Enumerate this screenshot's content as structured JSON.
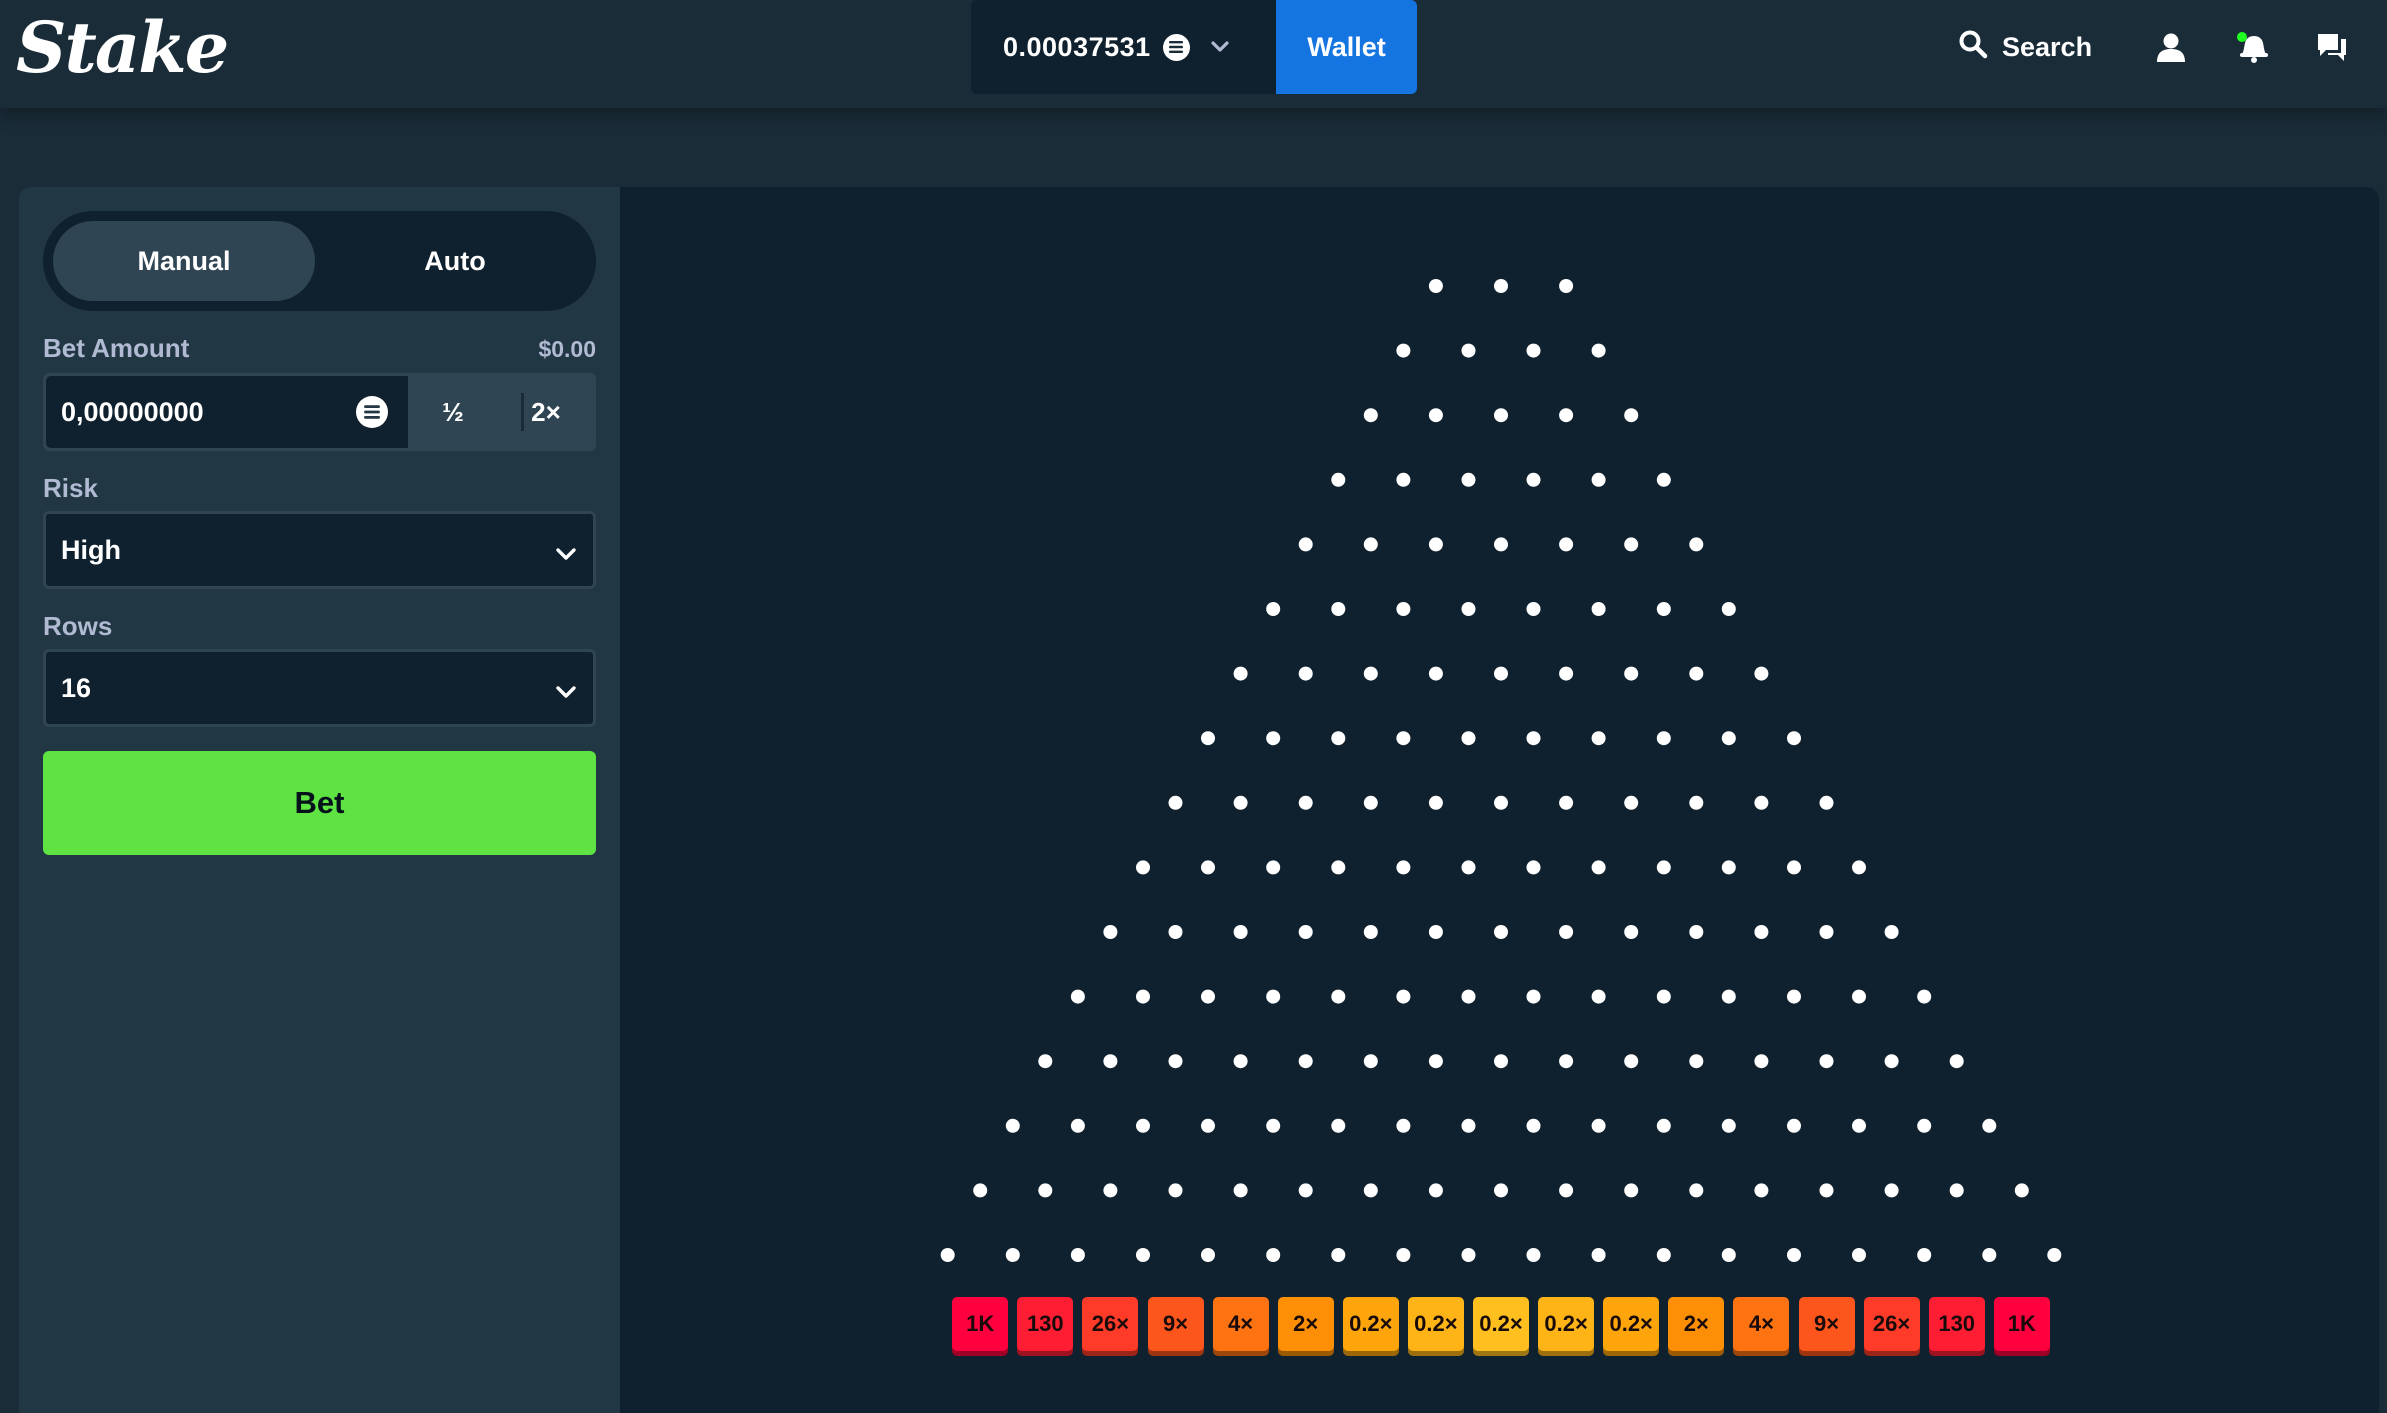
{
  "header": {
    "logo_text": "Stake",
    "balance": "0.00037531",
    "currency_icon": "coin-icon",
    "wallet_label": "Wallet",
    "search_label": "Search",
    "icons": [
      "user-icon",
      "notifications-icon",
      "chat-icon"
    ],
    "notification_dot_color": "#1fff20"
  },
  "sidebar": {
    "tabs": [
      {
        "label": "Manual",
        "active": true
      },
      {
        "label": "Auto",
        "active": false
      }
    ],
    "bet_amount": {
      "label": "Bet Amount",
      "usd_value": "$0.00",
      "value": "0,00000000",
      "half_label": "½",
      "double_label": "2×"
    },
    "risk": {
      "label": "Risk",
      "selected": "High"
    },
    "rows": {
      "label": "Rows",
      "selected": "16"
    },
    "bet_button_label": "Bet"
  },
  "board": {
    "rows": 16,
    "peg_color": "#ffffff",
    "multipliers": [
      "1K",
      "130",
      "26×",
      "9×",
      "4×",
      "2×",
      "0.2×",
      "0.2×",
      "0.2×",
      "0.2×",
      "0.2×",
      "2×",
      "4×",
      "9×",
      "26×",
      "130",
      "1K"
    ],
    "bucket_colors": [
      "#ff003f",
      "#fe1d33",
      "#fe3a28",
      "#fd561c",
      "#fd7311",
      "#fc8f05",
      "#fda50b",
      "#feb316",
      "#ffc01f",
      "#feb316",
      "#fda50b",
      "#fc8f05",
      "#fd7311",
      "#fd561c",
      "#fe3a28",
      "#fe1d33",
      "#ff003f"
    ]
  },
  "colors": {
    "background": "#1a2c38",
    "panel": "#213743",
    "game_bg": "#0f212e",
    "wallet_blue": "#1475e1",
    "bet_green": "#5ee342"
  }
}
